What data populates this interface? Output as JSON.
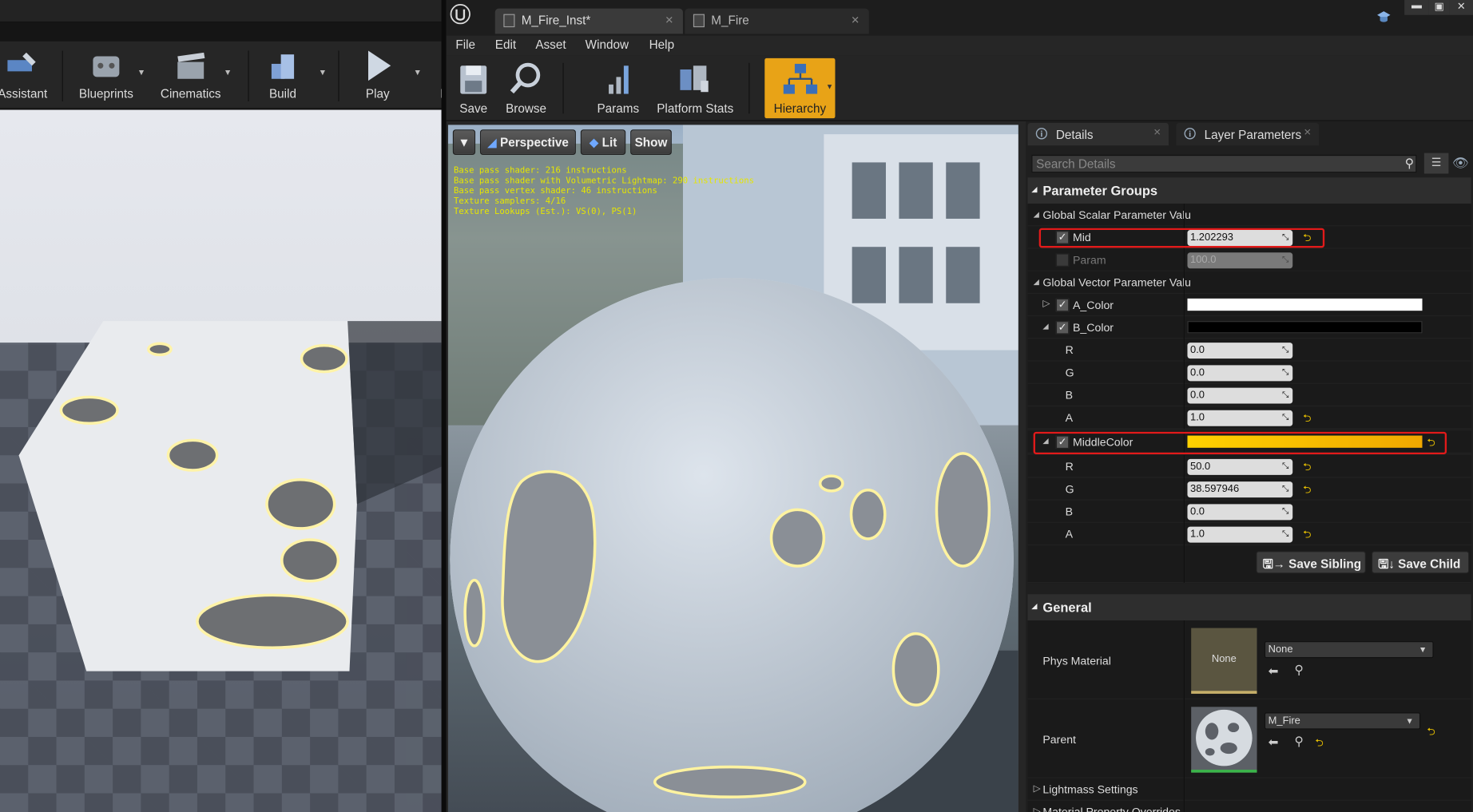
{
  "left_toolbar": {
    "items": [
      "Assistant",
      "Blueprints",
      "Cinematics",
      "Build",
      "Play",
      "L"
    ]
  },
  "tabs": [
    {
      "label": "M_Fire_Inst*"
    },
    {
      "label": "M_Fire"
    }
  ],
  "menu": [
    "File",
    "Edit",
    "Asset",
    "Window",
    "Help"
  ],
  "toolbar": {
    "save": "Save",
    "browse": "Browse",
    "params": "Params",
    "platform_stats": "Platform Stats",
    "hierarchy": "Hierarchy"
  },
  "viewport": {
    "perspective": "Perspective",
    "lit": "Lit",
    "show": "Show",
    "stats": [
      "Base pass shader: 216 instructions",
      "Base pass shader with Volumetric Lightmap: 290 instructions",
      "Base pass vertex shader: 46 instructions",
      "Texture samplers: 4/16",
      "Texture Lookups (Est.): VS(0), PS(1)"
    ]
  },
  "details": {
    "tab_details": "Details",
    "tab_layer": "Layer Parameters",
    "search_placeholder": "Search Details",
    "param_groups": "Parameter Groups",
    "scalar_group": "Global Scalar Parameter Valu",
    "mid_label": "Mid",
    "mid_value": "1.202293",
    "param_label": "Param",
    "param_value": "100.0",
    "vector_group": "Global Vector Parameter Valu",
    "a_color": "A_Color",
    "b_color": "B_Color",
    "b_r": "R",
    "b_r_value": "0.0",
    "b_g": "G",
    "b_g_value": "0.0",
    "b_b": "B",
    "b_b_value": "0.0",
    "b_a": "A",
    "b_a_value": "1.0",
    "middle_color": "MiddleColor",
    "m_r": "R",
    "m_r_value": "50.0",
    "m_g": "G",
    "m_g_value": "38.597946",
    "m_b": "B",
    "m_b_value": "0.0",
    "m_a": "A",
    "m_a_value": "1.0",
    "save_sibling": "Save Sibling",
    "save_child": "Save Child",
    "general": "General",
    "phys_material_label": "Phys Material",
    "phys_material_thumb": "None",
    "phys_material_value": "None",
    "parent_label": "Parent",
    "parent_value": "M_Fire",
    "lightmass": "Lightmass Settings",
    "material_overrides": "Material Property Overrides"
  },
  "colors": {
    "a_color": "#ffffff",
    "b_color": "#000000",
    "middle_color_start": "#ffd200",
    "middle_color_end": "#f0a800",
    "hierarchy_accent": "#e8a317",
    "highlight": "#e21a1a"
  }
}
